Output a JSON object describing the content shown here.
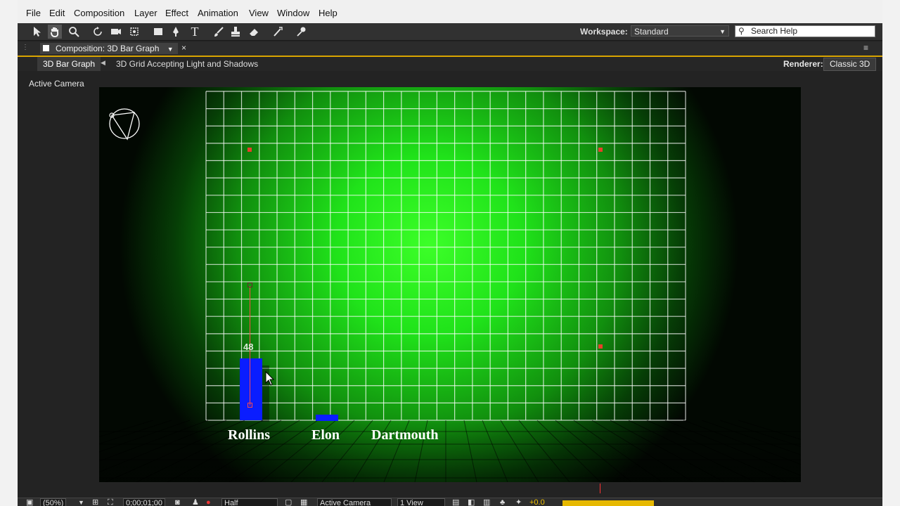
{
  "menu": [
    "File",
    "Edit",
    "Composition",
    "Layer",
    "Effect",
    "Animation",
    "View",
    "Window",
    "Help"
  ],
  "toolbar": {
    "tools": [
      "selection-tool-icon",
      "hand-tool-icon",
      "zoom-tool-icon",
      "rotate-tool-icon",
      "camera-orbit-icon",
      "pan-behind-icon",
      "rectangle-tool-icon",
      "pen-tool-icon",
      "type-tool-icon",
      "brush-tool-icon",
      "clone-stamp-icon",
      "eraser-icon",
      "roto-brush-icon",
      "puppet-pin-icon"
    ],
    "workspace_label": "Workspace:",
    "workspace_value": "Standard",
    "search_placeholder": "Search Help"
  },
  "panel": {
    "tab_title": "Composition: 3D Bar Graph",
    "breadcrumb_active": "3D Bar Graph",
    "breadcrumb_next": "3D Grid Accepting Light and Shadows",
    "renderer_label": "Renderer:",
    "renderer_value": "Classic 3D",
    "view_label": "Active Camera"
  },
  "viewer": {
    "background": "#050505",
    "glow_color": "#3cff28",
    "bars": [
      {
        "label": "Rollins",
        "value_text": "48",
        "color": "#0a1dff"
      },
      {
        "label": "Elon",
        "value_text": "",
        "color": "#0a1dff"
      },
      {
        "label": "Dartmouth",
        "value_text": "",
        "color": "#0a1dff"
      }
    ]
  },
  "status": {
    "zoom": "(50%)",
    "timecode": "0;00;01;00",
    "resolution": "Half",
    "view": "Active Camera",
    "views_count": "1 View",
    "exposure": "+0.0"
  }
}
